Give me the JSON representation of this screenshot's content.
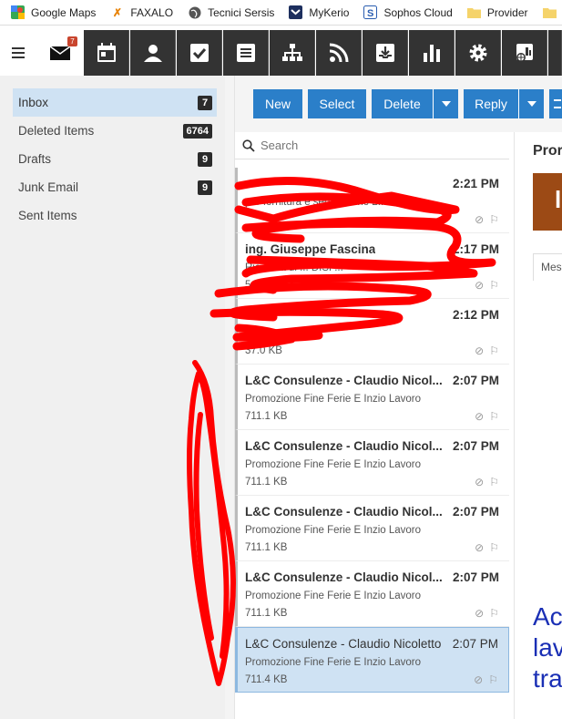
{
  "bookmarks": [
    {
      "label": "Google Maps",
      "icon": "map-pin-icon"
    },
    {
      "label": "FAXALO",
      "icon": "fax-icon"
    },
    {
      "label": "Tecnici Sersis",
      "icon": "globe-icon"
    },
    {
      "label": "MyKerio",
      "icon": "kerio-icon"
    },
    {
      "label": "Sophos Cloud",
      "icon": "sophos-icon"
    },
    {
      "label": "Provider",
      "icon": "folder-icon"
    }
  ],
  "app": {
    "mail_badge": "7",
    "modules": [
      "mail",
      "calendar",
      "contacts",
      "tasks",
      "notes",
      "org-chart",
      "rss",
      "archive",
      "reports",
      "settings",
      "admin",
      "more"
    ]
  },
  "folders": [
    {
      "name": "Inbox",
      "count": "7",
      "selected": true
    },
    {
      "name": "Deleted Items",
      "count": "6764"
    },
    {
      "name": "Drafts",
      "count": "9"
    },
    {
      "name": "Junk Email",
      "count": "9"
    },
    {
      "name": "Sent Items",
      "count": ""
    }
  ],
  "toolbar": {
    "new_label": "New",
    "select_label": "Select",
    "delete_label": "Delete",
    "reply_label": "Reply"
  },
  "search": {
    "placeholder": "Search"
  },
  "messages": [
    {
      "sender": "",
      "time": "2:21 PM",
      "subject": "per fornitura e servizi anno 2...",
      "size": ""
    },
    {
      "sender": "ing. Giuseppe Fascina",
      "time": "2:17 PM",
      "subject": "Ricevuta di ... DISP...",
      "size": "5.5 KB"
    },
    {
      "sender": "",
      "time": "2:12 PM",
      "subject": "",
      "size": "37.0 KB"
    },
    {
      "sender": "L&C Consulenze - Claudio Nicol...",
      "time": "2:07 PM",
      "subject": "Promozione Fine Ferie E Inzio Lavoro",
      "size": "711.1 KB"
    },
    {
      "sender": "L&C Consulenze - Claudio Nicol...",
      "time": "2:07 PM",
      "subject": "Promozione Fine Ferie E Inzio Lavoro",
      "size": "711.1 KB"
    },
    {
      "sender": "L&C Consulenze - Claudio Nicol...",
      "time": "2:07 PM",
      "subject": "Promozione Fine Ferie E Inzio Lavoro",
      "size": "711.1 KB"
    },
    {
      "sender": "L&C Consulenze - Claudio Nicol...",
      "time": "2:07 PM",
      "subject": "Promozione Fine Ferie E Inzio Lavoro",
      "size": "711.1 KB"
    },
    {
      "sender": "L&C Consulenze - Claudio Nicoletto",
      "time": "2:07 PM",
      "subject": "Promozione Fine Ferie E Inzio Lavoro",
      "size": "711.4 KB",
      "selected": true
    }
  ],
  "reading_pane": {
    "title": "Pror",
    "tab": "Mes",
    "body_lines": [
      "Ac",
      "lav",
      "tra"
    ]
  },
  "colors": {
    "accent": "#2b7fc9",
    "module_bar": "#333333",
    "selected_bg": "#cfe2f3",
    "badge": "#c9452e",
    "scribble": "#ff0000"
  }
}
